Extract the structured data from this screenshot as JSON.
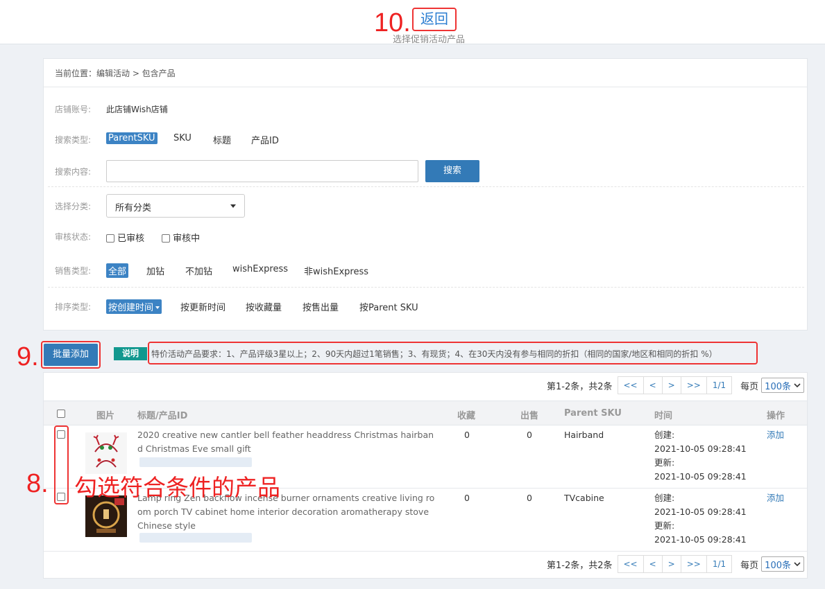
{
  "header": {
    "back_label": "返回",
    "subtitle": "选择促销活动产品"
  },
  "annotations": {
    "step10": "10.",
    "step9": "9.",
    "step8": "8.",
    "step8_text": "勾选符合条件的产品"
  },
  "breadcrumb": "当前位置：编辑活动 > 包含产品",
  "filters": {
    "store_label": "店铺账号:",
    "store_value": "此店铺Wish店铺",
    "search_type_label": "搜索类型:",
    "search_types": [
      "ParentSKU",
      "SKU",
      "标题",
      "产品ID"
    ],
    "search_content_label": "搜索内容:",
    "search_button": "搜索",
    "category_label": "选择分类:",
    "category_value": "所有分类",
    "review_label": "审核状态:",
    "review_options": [
      "已审核",
      "审核中"
    ],
    "sales_type_label": "销售类型:",
    "sales_types": [
      "全部",
      "加钻",
      "不加钻",
      "wishExpress",
      "非wishExpress"
    ],
    "sort_label": "排序类型:",
    "sort_types": [
      "按创建时间",
      "按更新时间",
      "按收藏量",
      "按售出量",
      "按Parent SKU"
    ]
  },
  "actions": {
    "bulk_add": "批量添加",
    "note_badge": "说明",
    "note_text": "特价活动产品要求：1、产品评级3星以上；2、90天内超过1笔销售；3、有现货；4、在30天内没有参与相同的折扣（相同的国家/地区和相同的折扣 %）"
  },
  "pager": {
    "summary": "第1-2条，共2条",
    "buttons": [
      "<<",
      "<",
      ">",
      ">>"
    ],
    "page": "1/1",
    "per_page_label": "每页",
    "per_page_value": "100条"
  },
  "table": {
    "headers": [
      "图片",
      "标题/产品ID",
      "收藏",
      "出售",
      "Parent SKU",
      "时间",
      "操作"
    ],
    "rows": [
      {
        "title": "2020 creative new cantler bell feather headdress Christmas hairband Christmas Eve small gift",
        "favorites": "0",
        "sold": "0",
        "parent_sku": "Hairband",
        "created_label": "创建:",
        "created": "2021-10-05 09:28:41",
        "updated_label": "更新:",
        "updated": "2021-10-05 09:28:41",
        "action": "添加"
      },
      {
        "title": "Lamp ring Zen backflow incense burner ornaments creative living room porch TV cabinet home interior decoration aromatherapy stove Chinese style",
        "favorites": "0",
        "sold": "0",
        "parent_sku": "TVcabine",
        "created_label": "创建:",
        "created": "2021-10-05 09:28:41",
        "updated_label": "更新:",
        "updated": "2021-10-05 09:28:41",
        "action": "添加"
      }
    ]
  },
  "colors": {
    "accent": "#337ab7",
    "annotation": "#e22222",
    "badge": "#12988f"
  }
}
